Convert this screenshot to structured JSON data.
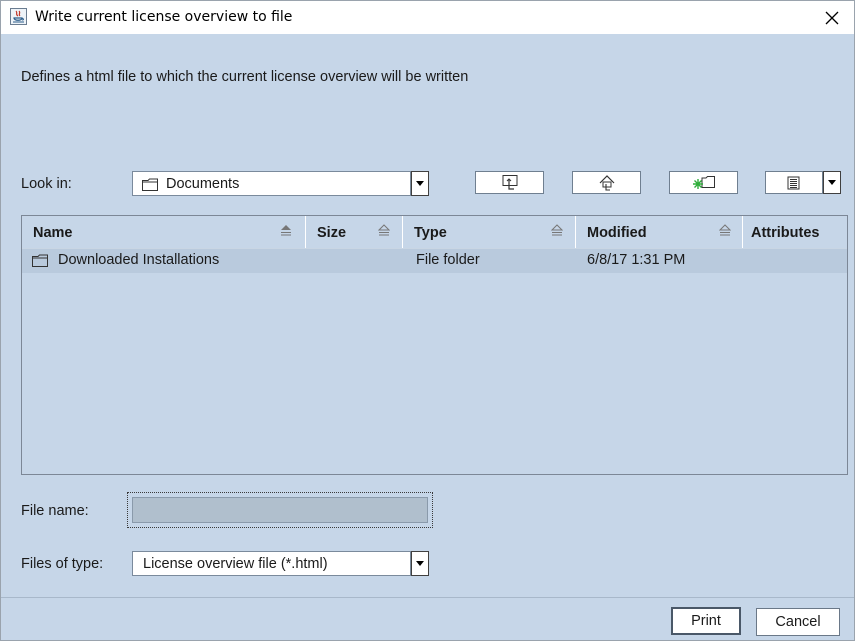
{
  "window": {
    "title": "Write current license overview to file"
  },
  "description": "Defines a html file to which the current license overview will be written",
  "look_in": {
    "label": "Look in:",
    "value": "Documents"
  },
  "toolbar": {
    "up_icon": "up-folder-icon",
    "home_icon": "home-icon",
    "new_folder_icon": "new-folder-icon",
    "view_icon": "list-view-icon"
  },
  "table": {
    "columns": [
      {
        "label": "Name"
      },
      {
        "label": "Size"
      },
      {
        "label": "Type"
      },
      {
        "label": "Modified"
      },
      {
        "label": "Attributes"
      }
    ],
    "rows": [
      {
        "name": "Downloaded Installations",
        "size": "",
        "type": "File folder",
        "modified": "6/8/17 1:31 PM",
        "attributes": ""
      }
    ]
  },
  "file_name": {
    "label": "File name:",
    "value": ""
  },
  "file_type": {
    "label": "Files of type:",
    "value": "License overview file (*.html)"
  },
  "buttons": {
    "print": "Print",
    "cancel": "Cancel"
  },
  "colors": {
    "dialog_bg": "#c6d6e8",
    "selected_row": "#b9cadd"
  }
}
